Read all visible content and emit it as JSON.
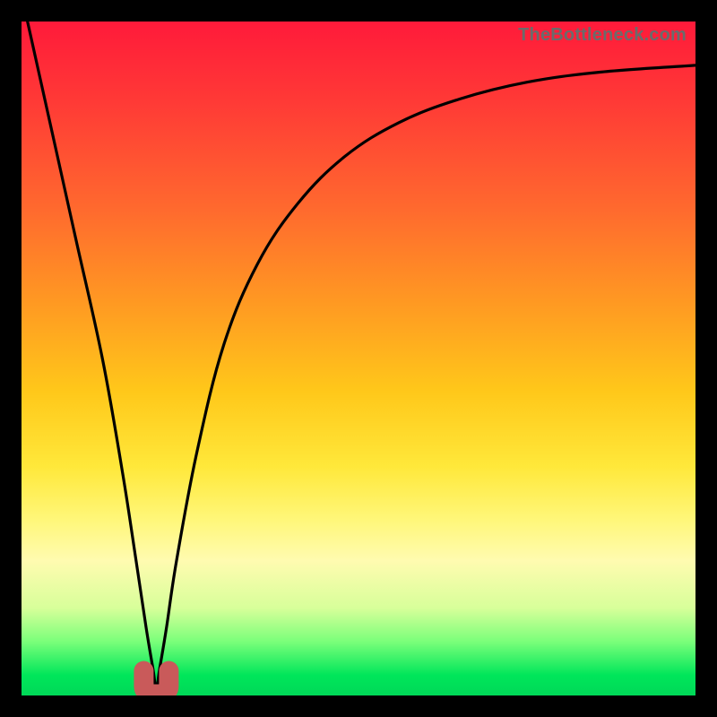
{
  "watermark": "TheBottleneck.com",
  "chart_data": {
    "type": "line",
    "title": "",
    "xlabel": "",
    "ylabel": "",
    "xlim": [
      0,
      100
    ],
    "ylim": [
      0,
      100
    ],
    "grid": false,
    "legend": false,
    "series": [
      {
        "name": "bottleneck-curve",
        "x": [
          0,
          4,
          8,
          12,
          15,
          17,
          18.5,
          19.5,
          20,
          20.5,
          21.5,
          23,
          26,
          30,
          35,
          41,
          48,
          56,
          65,
          75,
          86,
          100
        ],
        "y": [
          104,
          86,
          68,
          50,
          33,
          20,
          10,
          4,
          1,
          4,
          10,
          20,
          36,
          52,
          64,
          73,
          80,
          85,
          88.5,
          91,
          92.5,
          93.5
        ]
      }
    ],
    "annotations": [
      {
        "name": "min-marker",
        "shape": "u",
        "x": 20,
        "y": 1,
        "color": "#c95a5a"
      }
    ],
    "colors": {
      "curve": "#000000",
      "marker": "#c95a5a",
      "gradient_top": "#ff1a3a",
      "gradient_bottom": "#00d858"
    }
  }
}
